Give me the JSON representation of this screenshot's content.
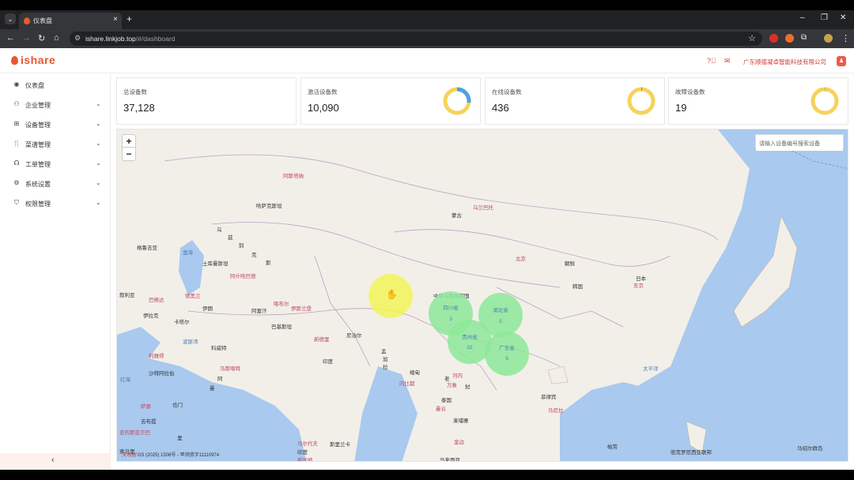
{
  "browser": {
    "tab_title": "仪表盘",
    "url_host": "ishare.linkjob.top",
    "url_path": "/#/dashboard"
  },
  "header": {
    "logo": "ishare",
    "company": "广东顺德凝卓智能科技有限公司",
    "avatar_icon": "user-icon",
    "help_icon": "question-circle-icon",
    "mail_icon": "mail-icon"
  },
  "sidebar": {
    "items": [
      {
        "label": "仪表盘",
        "icon": "dashboard-icon",
        "expandable": false
      },
      {
        "label": "企业管理",
        "icon": "org-icon",
        "expandable": true
      },
      {
        "label": "设备管理",
        "icon": "device-icon",
        "expandable": true
      },
      {
        "label": "菜谱管理",
        "icon": "fork-knife-icon",
        "expandable": true
      },
      {
        "label": "工单管理",
        "icon": "headset-icon",
        "expandable": true
      },
      {
        "label": "系统设置",
        "icon": "gears-icon",
        "expandable": true
      },
      {
        "label": "权限管理",
        "icon": "shield-icon",
        "expandable": true
      }
    ],
    "collapse_glyph": "‹"
  },
  "stats": [
    {
      "label": "总设备数",
      "value": "37,128"
    },
    {
      "label": "激活设备数",
      "value": "10,090",
      "ring_ratio": 0.27,
      "ring_color": "#4aa3df",
      "ring_bg": "#f5d35b"
    },
    {
      "label": "在线设备数",
      "value": "436",
      "ring_ratio": 0.012,
      "ring_color": "#4aa3df",
      "ring_bg": "#f5d35b"
    },
    {
      "label": "故障设备数",
      "value": "19",
      "ring_ratio": 0.0005,
      "ring_color": "#4aa3df",
      "ring_bg": "#f5d35b"
    }
  ],
  "map": {
    "search_placeholder": "请输入设备编号搜索设备",
    "zoom_in": "+",
    "zoom_out": "−",
    "attribution_logo": "天地图",
    "attribution": "GS (2025) 1508号 - 甲测资字11110974",
    "labels": {
      "l01": "阿斯塔纳",
      "l02": "哈萨克斯坦",
      "l03": "乌兰巴托",
      "l04": "蒙古",
      "l05": "乌",
      "l06": "兹",
      "l07": "别",
      "l08": "克",
      "l09": "斯",
      "l10": "格鲁吉亚",
      "l11": "里海",
      "l12": "土库曼斯坦",
      "l13": "阿什哈巴德",
      "l14": "德黑兰",
      "l15": "伊朗",
      "l16": "叙利亚",
      "l17": "巴格达",
      "l18": "伊拉克",
      "l19": "科威特",
      "l20": "波斯湾",
      "l21": "利雅得",
      "l22": "沙特阿拉伯",
      "l23": "阿富汗",
      "l24": "喀布尔",
      "l25": "伊斯兰堡",
      "l26": "巴基斯坦",
      "l27": "新德里",
      "l28": "印度",
      "l29": "尼泊尔",
      "l30": "孟",
      "l31": "加",
      "l32": "拉",
      "l33": "缅甸",
      "l34": "内比都",
      "l35": "中华人民共和国",
      "l36": "北京",
      "l37": "朝鲜",
      "l38": "韩国",
      "l39": "日本",
      "l40": "东京",
      "l41": "老",
      "l42": "挝",
      "l43": "河内",
      "l44": "泰国",
      "l45": "曼谷",
      "l46": "柬埔寨",
      "l47": "菲律宾",
      "l48": "马尼拉",
      "l49": "南海",
      "l50": "太平洋",
      "l51": "马来西亚",
      "l52": "新加坡",
      "l53": "印度",
      "l54": "密克罗尼西亚联邦",
      "l55": "马绍尔群岛",
      "l56": "帕劳",
      "l57": "阿曼",
      "l58": "也门",
      "l59": "马斯喀特",
      "l60": "阿布扎比",
      "l61": "萨那",
      "l62": "阿",
      "l63": "曼",
      "l64": "斯里兰卡",
      "l65": "马尔代夫",
      "l66": "万象",
      "l67": "里",
      "l68": "厄立特里亚",
      "l69": "吉布提",
      "l70": "亚的斯亚贝巴",
      "l71": "索马里",
      "l72": "红海",
      "l73": "卡塔尔",
      "l74": "巴林",
      "l75": "伊拉克",
      "l76": "安曼",
      "l77": "仰光",
      "l78": "金边",
      "l79": "吉隆坡",
      "l80": "斯",
      "l81": "坦"
    },
    "clusters": [
      {
        "name": "",
        "count": "",
        "color": "#f2f55a"
      },
      {
        "name": "四川省",
        "count": "3",
        "color": "#8ee89a"
      },
      {
        "name": "湖北省",
        "count": "5",
        "color": "#8ee89a"
      },
      {
        "name": "贵州省",
        "count": "32",
        "color": "#8ee89a"
      },
      {
        "name": "广东省",
        "count": "9",
        "color": "#8ee89a"
      }
    ]
  }
}
